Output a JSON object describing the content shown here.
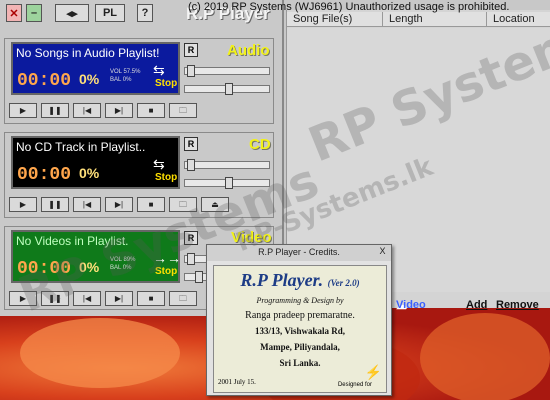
{
  "copyright": "(c) 2019 RP Systems (WJ6961) Unauthorized usage is prohibited.",
  "watermark": "RP Systems",
  "watermark2": "RP-Systems.lk",
  "toolbar": {
    "pl_label": "PL",
    "help_label": "?",
    "app_title": "R.P Player"
  },
  "audio": {
    "label": "Audio",
    "title": "No Songs in Audio Playlist!",
    "time": "00:00",
    "pct": "0%",
    "vol": "VOL 57.5%",
    "bal": "BAL 0%",
    "stop": "Stop",
    "r": "R"
  },
  "cd": {
    "label": "CD",
    "title": "No CD Track in Playlist..",
    "time": "00:00",
    "pct": "0%",
    "stop": "Stop",
    "r": "R"
  },
  "video": {
    "label": "Video",
    "title": "No Videos in Playlist.",
    "time": "00:00",
    "pct": "0%",
    "vol": "VOL 89%",
    "bal": "BAL 0%",
    "stop": "Stop",
    "r": "R"
  },
  "playlist": {
    "columns": [
      "Song File(s)",
      "Length",
      "Location"
    ],
    "video_link": "Video",
    "add": "Add",
    "remove": "Remove"
  },
  "credits": {
    "window_title": "R.P Player - Credits.",
    "close": "X",
    "logo": "R.P Player.",
    "version": "(Ver 2.0)",
    "tagline": "Programming & Design by",
    "name": "Ranga pradeep premaratne.",
    "addr1": "133/13, Vishwakala Rd,",
    "addr2": "Mampe, Piliyandala,",
    "addr3": "Sri Lanka.",
    "date": "2001 July 15.",
    "designed_for": "Designed for"
  },
  "colors": {
    "audio_panel": "#0b1a9e",
    "cd_panel": "#000000",
    "video_panel": "#0f7a1a",
    "accent": "#f2f21a"
  }
}
